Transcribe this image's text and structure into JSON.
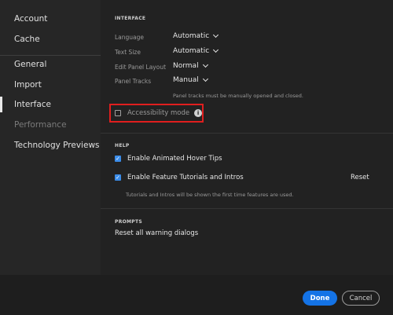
{
  "sidebar": {
    "items": [
      {
        "label": "Account"
      },
      {
        "label": "Cache"
      },
      {
        "label": "General"
      },
      {
        "label": "Import"
      },
      {
        "label": "Interface"
      },
      {
        "label": "Performance"
      },
      {
        "label": "Technology Previews"
      }
    ],
    "active": "Interface"
  },
  "interface": {
    "heading": "INTERFACE",
    "language": {
      "label": "Language",
      "value": "Automatic"
    },
    "text_size": {
      "label": "Text Size",
      "value": "Automatic"
    },
    "edit_panel_layout": {
      "label": "Edit Panel Layout",
      "value": "Normal"
    },
    "panel_tracks": {
      "label": "Panel Tracks",
      "value": "Manual",
      "hint": "Panel tracks must be manually opened and closed."
    },
    "accessibility_mode": {
      "label": "Accessibility mode",
      "checked": false,
      "info_icon": "info-icon"
    }
  },
  "help": {
    "heading": "HELP",
    "hover_tips": {
      "label": "Enable Animated Hover Tips",
      "checked": true
    },
    "tutorials": {
      "label": "Enable Feature Tutorials and Intros",
      "checked": true
    },
    "reset_label": "Reset",
    "hint": "Tutorials and Intros will be shown the first time features are used."
  },
  "prompts": {
    "heading": "PROMPTS",
    "reset_warnings": "Reset all warning dialogs"
  },
  "footer": {
    "done_label": "Done",
    "cancel_label": "Cancel"
  },
  "colors": {
    "accent": "#1473e6",
    "highlight_box": "#e01e1e"
  }
}
